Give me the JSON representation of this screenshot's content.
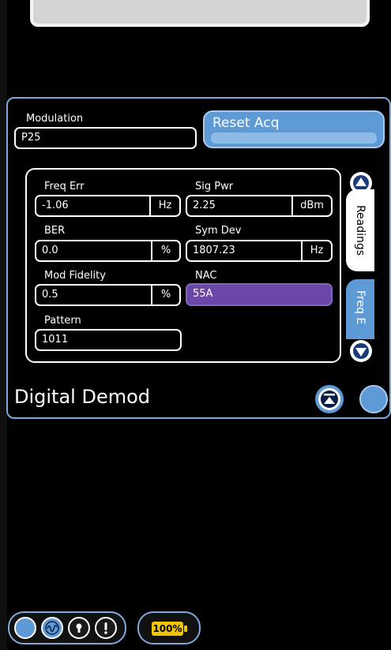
{
  "modulation": {
    "label": "Modulation",
    "value": "P25"
  },
  "reset_button": {
    "label": "Reset Acq"
  },
  "readings": {
    "freq_err": {
      "label": "Freq Err",
      "value": "-1.06",
      "unit": "Hz"
    },
    "sig_pwr": {
      "label": "Sig Pwr",
      "value": "2.25",
      "unit": "dBm"
    },
    "ber": {
      "label": "BER",
      "value": "0.0",
      "unit": "%"
    },
    "sym_dev": {
      "label": "Sym Dev",
      "value": "1807.23",
      "unit": "Hz"
    },
    "mod_fidelity": {
      "label": "Mod Fidelity",
      "value": "0.5",
      "unit": "%"
    },
    "nac": {
      "label": "NAC",
      "value": "55A"
    },
    "pattern": {
      "label": "Pattern",
      "value": "1011"
    }
  },
  "tabs": {
    "readings": "Readings",
    "freq": "Freq E"
  },
  "panel_title": "Digital Demod",
  "status": {
    "battery": "100%"
  },
  "colors": {
    "accent": "#5d9ad6",
    "border": "#7fa9dc",
    "nac": "#6b47a8",
    "battery": "#f0c400"
  }
}
